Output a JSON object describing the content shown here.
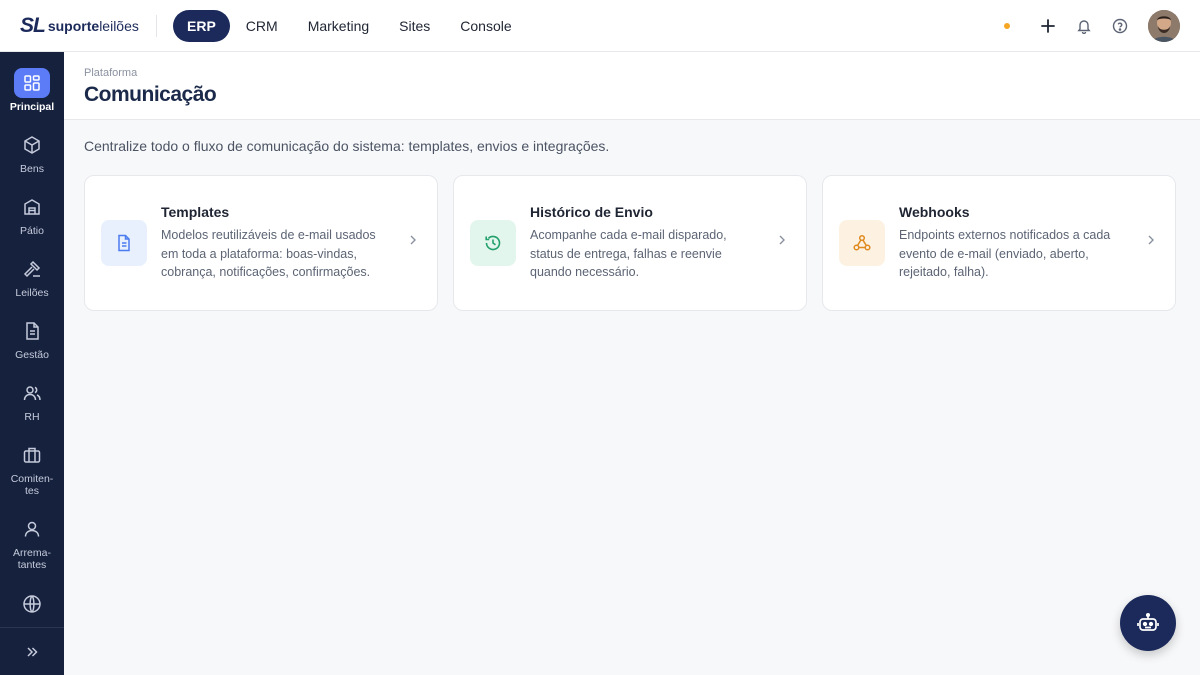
{
  "brand": {
    "mark": "SL",
    "name_bold": "suporte",
    "name_light": "leilões"
  },
  "topnav": [
    {
      "label": "ERP",
      "active": true
    },
    {
      "label": "CRM",
      "active": false
    },
    {
      "label": "Marketing",
      "active": false
    },
    {
      "label": "Sites",
      "active": false
    },
    {
      "label": "Console",
      "active": false
    }
  ],
  "sidebar": {
    "items": [
      {
        "label": "Principal",
        "icon": "grid-icon",
        "active": true
      },
      {
        "label": "Bens",
        "icon": "box-icon"
      },
      {
        "label": "Pátio",
        "icon": "warehouse-icon"
      },
      {
        "label": "Leilões",
        "icon": "gavel-icon"
      },
      {
        "label": "Gestão",
        "icon": "document-icon"
      },
      {
        "label": "RH",
        "icon": "users-icon"
      },
      {
        "label": "Comiten-\ntes",
        "icon": "briefcase-icon"
      },
      {
        "label": "Arrema-\ntantes",
        "icon": "user-icon"
      },
      {
        "label": "",
        "icon": "globe-icon"
      }
    ]
  },
  "header": {
    "breadcrumb": "Plataforma",
    "title": "Comunicação"
  },
  "intro": "Centralize todo o fluxo de comunicação do sistema: templates, envios e integrações.",
  "cards": [
    {
      "title": "Templates",
      "description": "Modelos reutilizáveis de e-mail usados em toda a plataforma: boas-vindas, cobrança, notificações, confirmações.",
      "icon": "file-text-icon",
      "accent": "#4a7cf0",
      "tint": "#e8effd"
    },
    {
      "title": "Histórico de Envio",
      "description": "Acompanhe cada e-mail disparado, status de entrega, falhas e reenvie quando necessário.",
      "icon": "history-icon",
      "accent": "#22a06b",
      "tint": "#e3f6ee"
    },
    {
      "title": "Webhooks",
      "description": "Endpoints externos notificados a cada evento de e-mail (enviado, aberto, rejeitado, falha).",
      "icon": "webhook-icon",
      "accent": "#e08a1e",
      "tint": "#fdf1e2"
    }
  ],
  "colors": {
    "navy": "#1b2a5a",
    "sidebar": "#16213e",
    "active": "#5b7cf6",
    "status_dot": "#f5a623"
  }
}
